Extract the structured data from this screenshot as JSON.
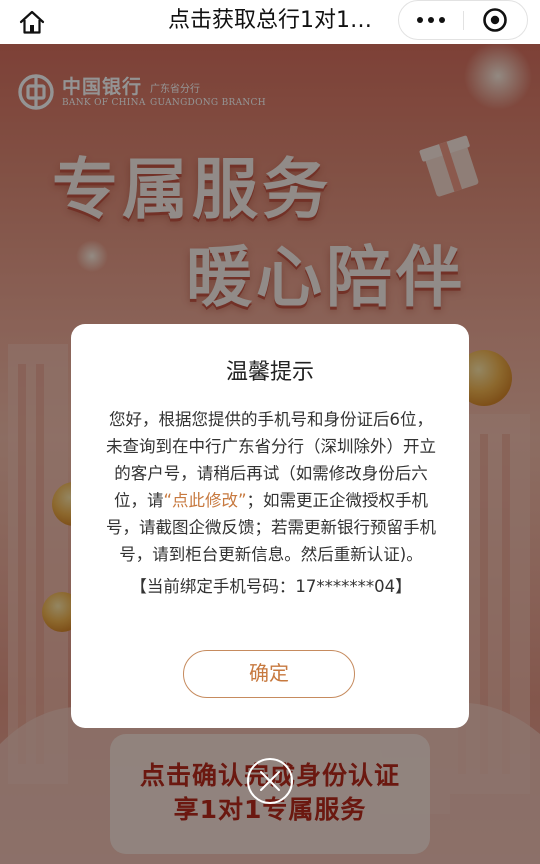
{
  "nav": {
    "title": "点击获取总行1对1…"
  },
  "bank": {
    "name_cn": "中国银行",
    "name_en": "BANK OF CHINA",
    "branch_cn": "广东省分行",
    "branch_en": "GUANGDONG BRANCH"
  },
  "poster": {
    "headline_line1": "专属服务",
    "headline_line2": "暖心陪伴",
    "cta_line1": "点击确认完成身份认证",
    "cta_line2": "享1对1专属服务"
  },
  "dialog": {
    "title": "温馨提示",
    "body_before_link": "您好，根据您提供的手机号和身份证后6位，未查询到在中行广东省分行（深圳除外）开立的客户号，请稍后再试（如需修改身份后六位，请",
    "link_text": "“点此修改”",
    "body_after_link": "；如需更正企微授权手机号，请截图企微反馈；若需更新银行预留手机号，请到柜台更新信息。然后重新认证)。",
    "phone_line": "【当前绑定手机号码：17*******04】",
    "confirm_label": "确定"
  },
  "colors": {
    "accent": "#c7793f",
    "cta_red": "#b82a1c"
  },
  "icons": {
    "home": "home-icon",
    "more": "more-dots-icon",
    "close_miniprogram": "close-circle-icon",
    "dialog_close": "close-icon"
  }
}
